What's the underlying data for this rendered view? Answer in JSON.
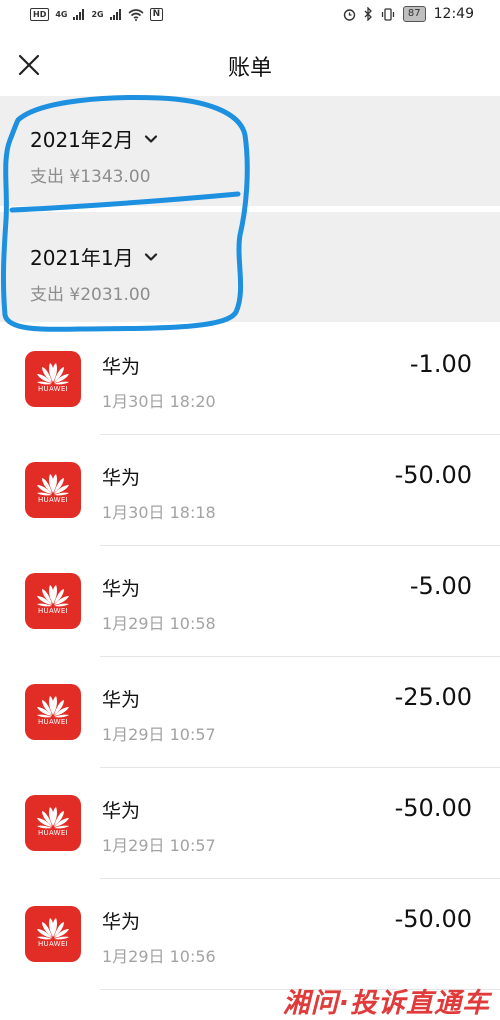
{
  "status_bar": {
    "hd": "HD",
    "signal_1": "4G",
    "signal_2": "2G",
    "wifi_icon": "wifi-icon",
    "nfc": "N",
    "alarm_icon": "alarm-icon",
    "bluetooth_icon": "bluetooth-icon",
    "vibrate_icon": "vibrate-icon",
    "battery": "87",
    "time": "12:49"
  },
  "header": {
    "close_icon": "close-icon",
    "title": "账单"
  },
  "months": [
    {
      "title": "2021年2月",
      "expense": "支出 ¥1343.00"
    },
    {
      "title": "2021年1月",
      "expense": "支出 ¥2031.00"
    }
  ],
  "transactions": [
    {
      "merchant": "华为",
      "time": "1月30日 18:20",
      "amount": "-1.00",
      "logo_text": "HUAWEI"
    },
    {
      "merchant": "华为",
      "time": "1月30日 18:18",
      "amount": "-50.00",
      "logo_text": "HUAWEI"
    },
    {
      "merchant": "华为",
      "time": "1月29日 10:58",
      "amount": "-5.00",
      "logo_text": "HUAWEI"
    },
    {
      "merchant": "华为",
      "time": "1月29日 10:57",
      "amount": "-25.00",
      "logo_text": "HUAWEI"
    },
    {
      "merchant": "华为",
      "time": "1月29日 10:57",
      "amount": "-50.00",
      "logo_text": "HUAWEI"
    },
    {
      "merchant": "华为",
      "time": "1月29日 10:56",
      "amount": "-50.00",
      "logo_text": "HUAWEI"
    }
  ],
  "watermark": "湘问·投诉直通车",
  "colors": {
    "brand_red": "#e22d27",
    "section_bg": "#efefef",
    "annotation_blue": "#1e90e0"
  }
}
